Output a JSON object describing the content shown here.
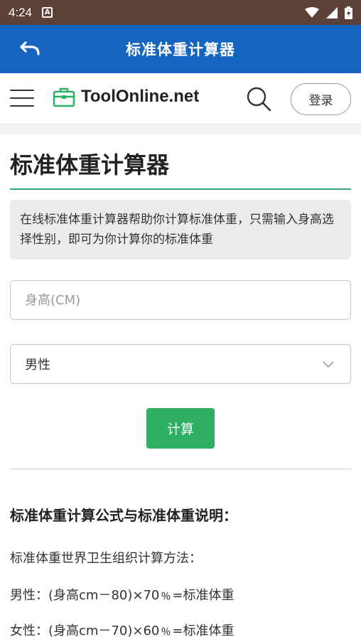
{
  "status_bar": {
    "time": "4:24",
    "notification_icon": "A"
  },
  "app_bar": {
    "title": "标准体重计算器"
  },
  "site_header": {
    "logo_text": "ToolOnline.net",
    "login_label": "登录"
  },
  "main": {
    "page_title": "标准体重计算器",
    "description": "在线标准体重计算器帮助你计算标准体重，只需输入身高选择性别，即可为你计算你的标准体重",
    "height_input": {
      "placeholder": "身高(CM)",
      "value": ""
    },
    "gender_select": {
      "selected": "男性"
    },
    "calc_button": "计算",
    "section_title": "标准体重计算公式与标准体重说明：",
    "paragraphs": [
      "标准体重世界卫生组织计算方法：",
      "男性：(身高cm－80)×70﹪=标准体重",
      "女性：(身高cm－70)×60﹪=标准体重"
    ]
  },
  "colors": {
    "status_bar": "#5d4037",
    "app_bar": "#1565c0",
    "accent_green": "#2eaf63"
  }
}
